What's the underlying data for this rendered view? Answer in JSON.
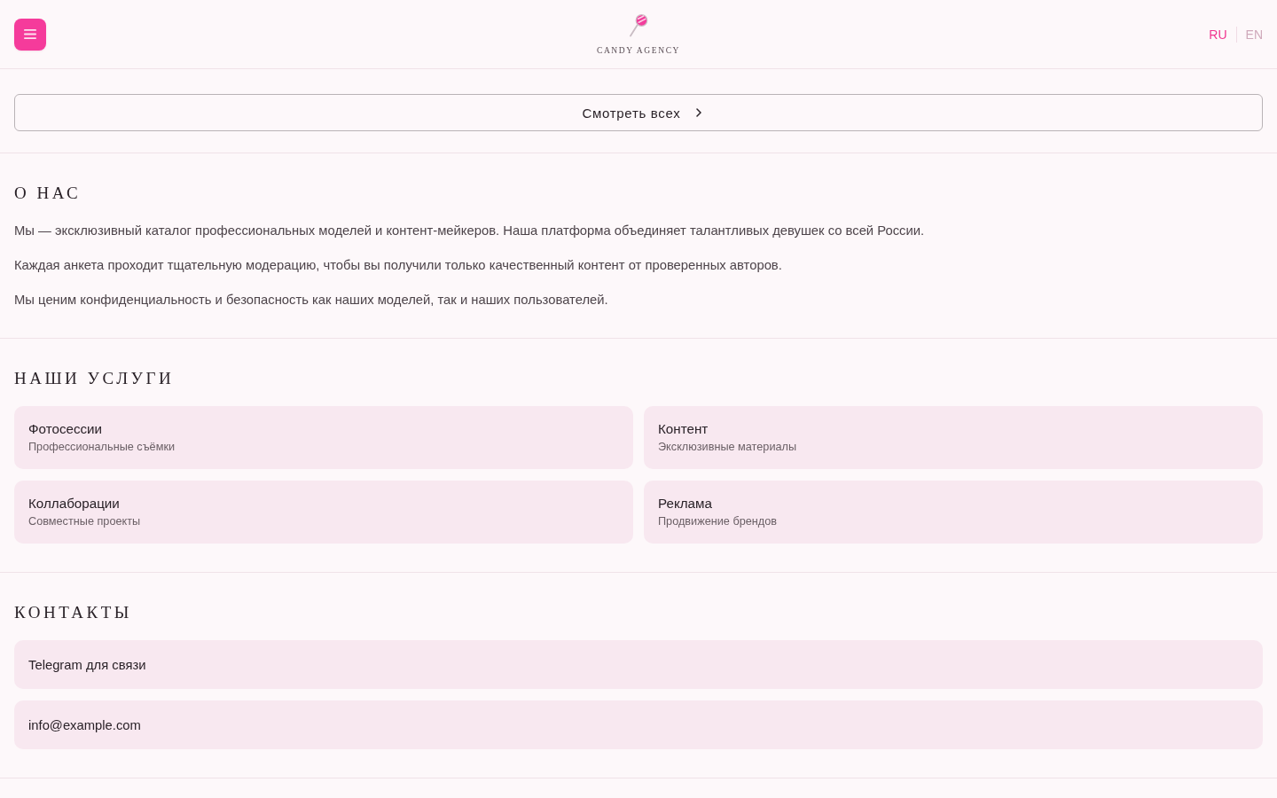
{
  "header": {
    "logo": {
      "text": "CANDY AGENCY"
    },
    "languages": [
      {
        "label": "RU",
        "selected": true
      },
      {
        "label": "EN",
        "selected": false
      }
    ]
  },
  "view_all": {
    "label": "Смотреть всех"
  },
  "about": {
    "heading": "О НАС",
    "paragraphs": [
      "Мы — эксклюзивный каталог профессиональных моделей и контент-мейкеров. Наша платформа объединяет талантливых девушек со всей России.",
      "Каждая анкета проходит тщательную модерацию, чтобы вы получили только качественный контент от проверенных авторов.",
      "Мы ценим конфиденциальность и безопасность как наших моделей, так и наших пользователей."
    ]
  },
  "services": {
    "heading": "НАШИ УСЛУГИ",
    "items": [
      {
        "title": "Фотосессии",
        "subtitle": "Профессиональные съёмки"
      },
      {
        "title": "Контент",
        "subtitle": "Эксклюзивные материалы"
      },
      {
        "title": "Коллаборации",
        "subtitle": "Совместные проекты"
      },
      {
        "title": "Реклама",
        "subtitle": "Продвижение брендов"
      }
    ]
  },
  "contacts": {
    "heading": "КОНТАКТЫ",
    "items": [
      "Telegram для связи",
      "info@example.com"
    ]
  }
}
